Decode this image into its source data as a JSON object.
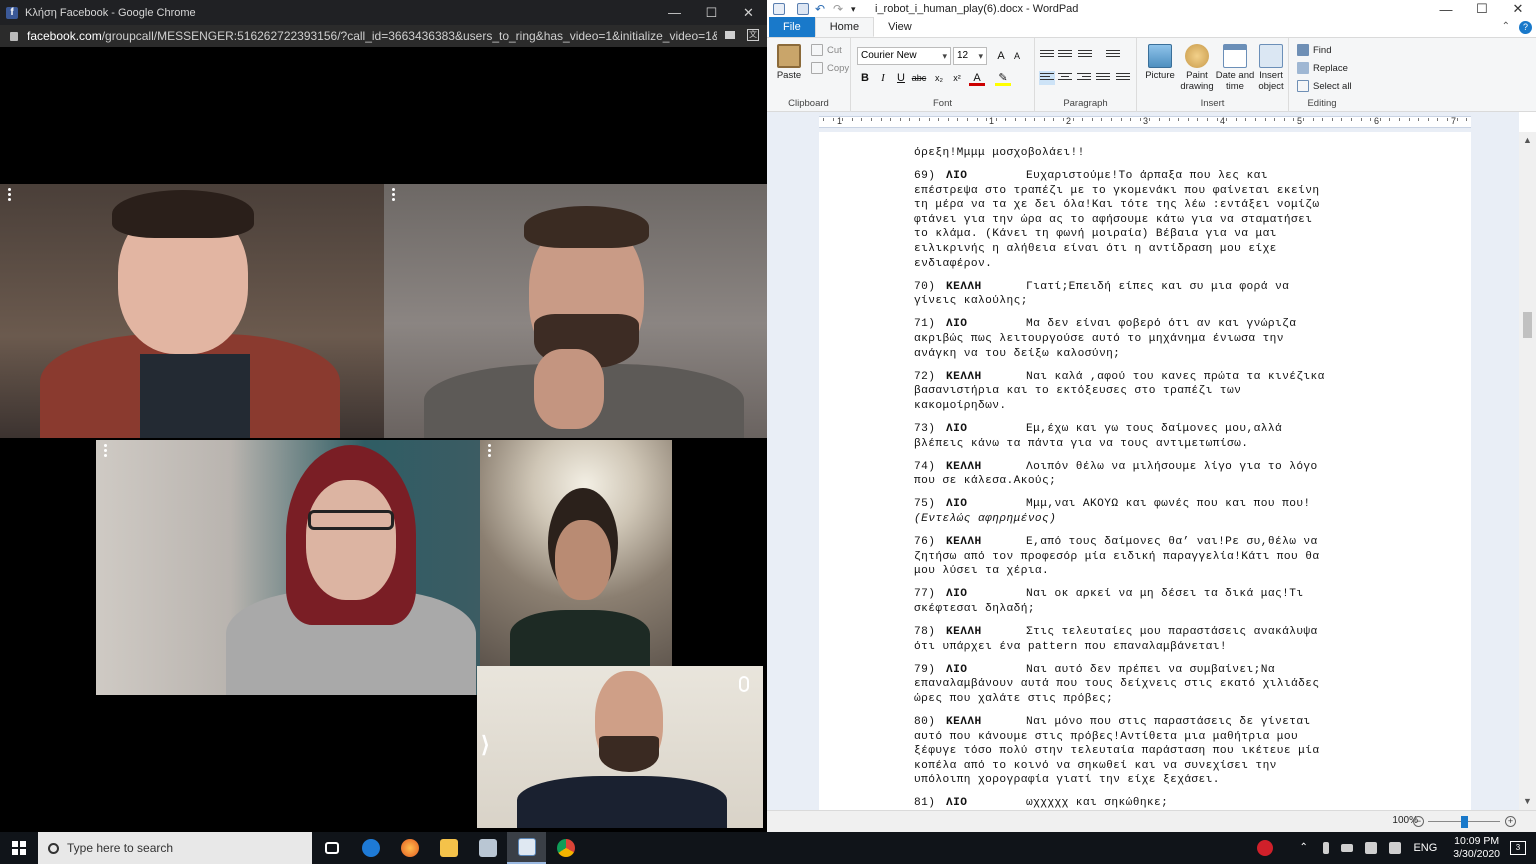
{
  "chrome": {
    "title": "Κλήση Facebook - Google Chrome",
    "url_domain": "facebook.com",
    "url_rest": "/groupcall/MESSENGER:516262722393156/?call_id=3663436383&users_to_ring&has_video=1&initialize_video=1&server_i..."
  },
  "wordpad": {
    "title": "i_robot_i_human_play(6).docx - WordPad",
    "tabs": [
      "File",
      "Home",
      "View"
    ],
    "clipboard": {
      "paste": "Paste",
      "cut": "Cut",
      "copy": "Copy",
      "label": "Clipboard"
    },
    "font": {
      "family": "Courier New",
      "size": "12",
      "label": "Font"
    },
    "paragraph_label": "Paragraph",
    "insert": {
      "picture": "Picture",
      "paint": "Paint drawing",
      "datetime": "Date and time",
      "object": "Insert object",
      "label": "Insert"
    },
    "editing": {
      "find": "Find",
      "replace": "Replace",
      "select_all": "Select all",
      "label": "Editing"
    },
    "ruler_numbers": [
      "1",
      "1",
      "2",
      "3",
      "4",
      "5",
      "6",
      "7"
    ],
    "zoom": "100%"
  },
  "document": {
    "lead": "όρεξη!Μμμμ μοσχοβολάει!!",
    "lines": [
      {
        "n": "69)",
        "spk": "ΛΙΟ",
        "first": "Ευχαριστούμε!Το άρπαξα που λες και",
        "rest": [
          "επέστρεψα στο τραπέζι με το γκομενάκι που φαίνεται εκείνη",
          "τη μέρα να τα χε δει όλα!Και τότε της λέω :εντάξει νομίζω",
          "φτάνει για την ώρα ας το αφήσουμε κάτω για να σταματήσει",
          "το κλάμα. (Κάνει τη φωνή μοιραία) Βέβαια για να μαι",
          "ειλικρινής η αλήθεια είναι ότι η αντίδραση μου είχε",
          "ενδιαφέρον."
        ]
      },
      {
        "n": "70)",
        "spk": "ΚΕΛΛΗ",
        "first": "Γιατί;Επειδή είπες και συ μια φορά να",
        "rest": [
          "γίνεις καλούλης;"
        ]
      },
      {
        "n": "71)",
        "spk": "ΛΙΟ",
        "first": "Μα δεν είναι φοβερό ότι αν και γνώριζα",
        "rest": [
          "ακριβώς πως λειτουργούσε αυτό το μηχάνημα ένιωσα την",
          "ανάγκη να του δείξω καλοσύνη;"
        ]
      },
      {
        "n": "72)",
        "spk": "ΚΕΛΛΗ",
        "first": "Ναι καλά ,αφού του κανες πρώτα τα κινέζικα",
        "rest": [
          "βασανιστήρια και το εκτόξευσες στο τραπέζι των",
          "κακομοίρηδων."
        ]
      },
      {
        "n": "73)",
        "spk": "ΛΙΟ",
        "first": "Εμ,έχω και γω τους δαίμονες μου,αλλά",
        "rest": [
          "βλέπεις κάνω τα πάντα για να τους αντιμετωπίσω."
        ]
      },
      {
        "n": "74)",
        "spk": "ΚΕΛΛΗ",
        "first": "Λοιπόν θέλω να μιλήσουμε λίγο για το λόγο",
        "rest": [
          "που σε κάλεσα.Ακούς;"
        ]
      },
      {
        "n": "75)",
        "spk": "ΛΙΟ",
        "first": "Μμμ,ναι ΑΚΟΥΩ και φωνές που και που που!",
        "rest": [
          "(Εντελώς αφηρημένος)"
        ]
      },
      {
        "n": "76)",
        "spk": "ΚΕΛΛΗ",
        "first": "Ε,από τους δαίμονες θα’ ναι!Ρε συ,θέλω να",
        "rest": [
          "ζητήσω από τον προφεσόρ μία ειδική παραγγελία!Κάτι που θα",
          "μου λύσει τα χέρια."
        ]
      },
      {
        "n": "77)",
        "spk": "ΛΙΟ",
        "first": "Ναι οκ αρκεί  να μη δέσει τα δικά μας!Τι",
        "rest": [
          "σκέφτεσαι δηλαδή;"
        ]
      },
      {
        "n": "78)",
        "spk": "ΚΕΛΛΗ",
        "first": "Στις τελευταίες μου παραστάσεις ανακάλυψα",
        "rest": [
          "ότι υπάρχει ένα pattern που επαναλαμβάνεται!"
        ]
      },
      {
        "n": "79)",
        "spk": "ΛΙΟ",
        "first": "Ναι αυτό δεν πρέπει να συμβαίνει;Να",
        "rest": [
          "επαναλαμβάνουν αυτά που τους δείχνεις στις εκατό χιλιάδες",
          "ώρες που χαλάτε στις πρόβες;"
        ]
      },
      {
        "n": "80)",
        "spk": "ΚΕΛΛΗ",
        "first": "Ναι μόνο που στις παραστάσεις  δε γίνεται",
        "rest": [
          "αυτό που κάνουμε στις πρόβες!Αντίθετα μια μαθήτρια μου",
          "ξέφυγε τόσο πολύ στην τελευταία παράσταση που ικέτευε μία",
          "κοπέλα από το κοινό να σηκωθεί και να συνεχίσει την",
          "υπόλοιπη χορογραφία γιατί την είχε ξεχάσει."
        ]
      },
      {
        "n": "81)",
        "spk": "ΛΙΟ",
        "first": "ωχχχχχ και σηκώθηκε;",
        "rest": []
      }
    ]
  },
  "taskbar": {
    "search_placeholder": "Type here to search",
    "lang": "ENG",
    "time": "10:09 PM",
    "date": "3/30/2020",
    "notifications": "3"
  }
}
